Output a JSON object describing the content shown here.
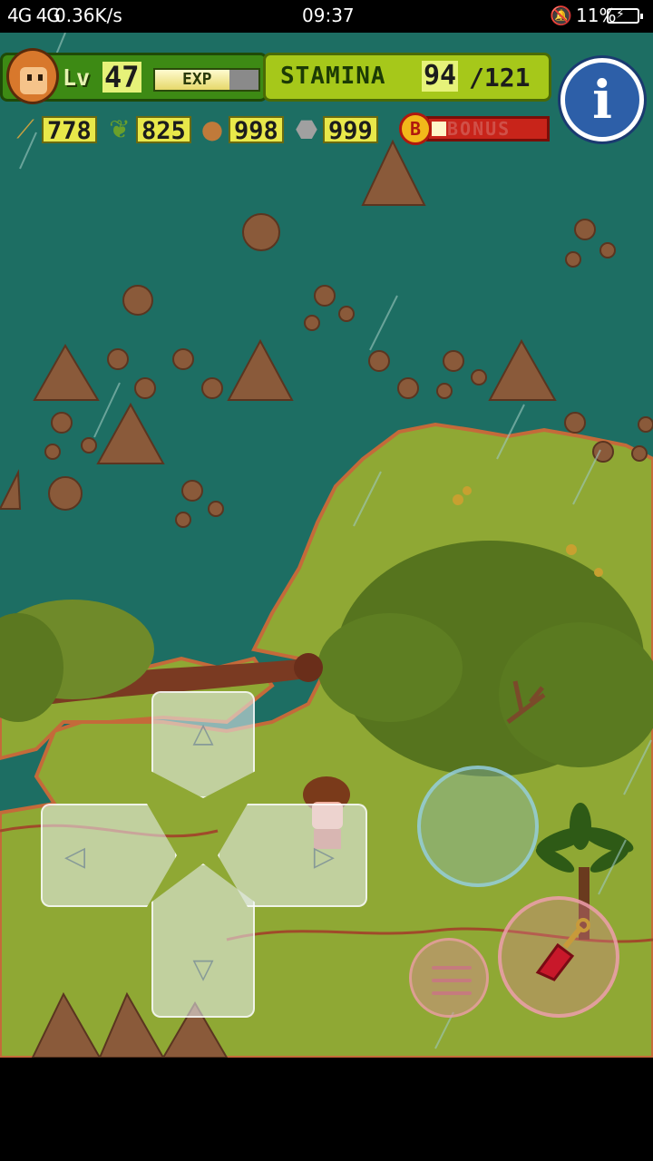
{
  "status_bar": {
    "signal": "4G 4G",
    "speed": "0.36K/s",
    "time": "09:37",
    "battery": "11%"
  },
  "hud": {
    "level_label": "Lv",
    "level": "47",
    "exp_label": "EXP",
    "exp_fraction": 0.72,
    "stamina_label": "STAMINA",
    "stamina_current": "94",
    "stamina_max": "/121",
    "resources": [
      {
        "name": "branch",
        "icon": "branch-icon",
        "value": "778"
      },
      {
        "name": "leaves",
        "icon": "leaf-icon",
        "value": "825"
      },
      {
        "name": "nuts",
        "icon": "nut-icon",
        "value": "998"
      },
      {
        "name": "stone",
        "icon": "stone-icon",
        "value": "999"
      }
    ],
    "bonus_badge": "B",
    "bonus_label": "BONUS",
    "bonus_fraction": 0.12
  },
  "controls": {
    "up": "△",
    "down": "▽",
    "left": "◁",
    "right": "▷"
  },
  "colors": {
    "sea": "#1d6e63",
    "grass": "#8fa834",
    "rock": "#8a5a3a",
    "stamina": "#a6c81a"
  }
}
